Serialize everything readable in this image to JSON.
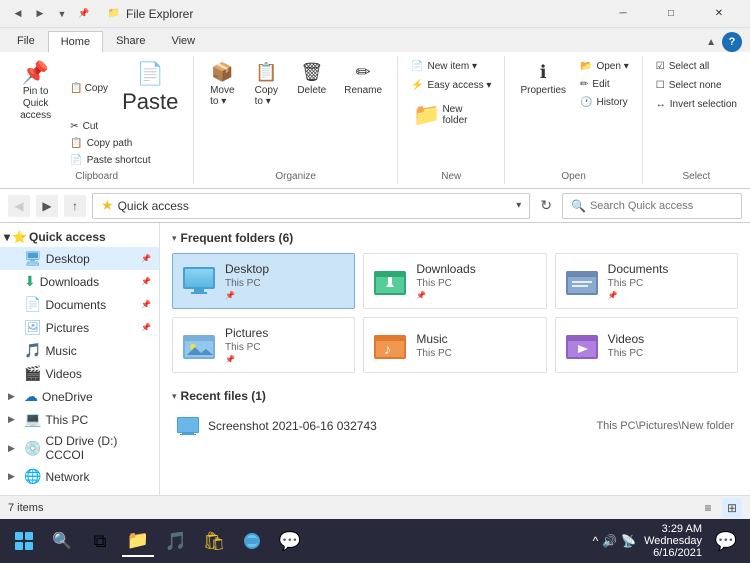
{
  "titleBar": {
    "icon": "📁",
    "title": "File Explorer",
    "minBtn": "─",
    "maxBtn": "□",
    "closeBtn": "✕",
    "quickBtns": [
      "◀",
      "▶",
      "▼",
      "▲",
      "⬛"
    ]
  },
  "ribbon": {
    "tabs": [
      "File",
      "Home",
      "Share",
      "View"
    ],
    "activeTab": "Home",
    "groups": {
      "clipboard": {
        "label": "Clipboard",
        "pinBtn": "📌",
        "buttons": [
          {
            "id": "pin",
            "icon": "📌",
            "label": "Pin to Quick\naccess"
          },
          {
            "id": "copy",
            "icon": "📋",
            "label": "Copy"
          },
          {
            "id": "paste",
            "icon": "📄",
            "label": "Paste"
          }
        ],
        "smallBtns": [
          {
            "id": "cut",
            "icon": "✂",
            "label": "Cut"
          },
          {
            "id": "copypath",
            "icon": "📋",
            "label": "Copy path"
          },
          {
            "id": "pasteshortcut",
            "icon": "📄",
            "label": "Paste shortcut"
          }
        ]
      },
      "organize": {
        "label": "Organize",
        "buttons": [
          {
            "id": "moveto",
            "icon": "📦",
            "label": "Move\nto ▾"
          },
          {
            "id": "copyto",
            "icon": "📋",
            "label": "Copy\nto ▾"
          },
          {
            "id": "delete",
            "icon": "🗑",
            "label": "Delete"
          },
          {
            "id": "rename",
            "icon": "✏",
            "label": "Rename"
          }
        ]
      },
      "new": {
        "label": "New",
        "buttons": [
          {
            "id": "newitem",
            "icon": "📄",
            "label": "New item ▾"
          },
          {
            "id": "easyaccess",
            "icon": "⚡",
            "label": "Easy access ▾"
          },
          {
            "id": "newfolder",
            "icon": "📁",
            "label": "New\nfolder"
          }
        ]
      },
      "open": {
        "label": "Open",
        "buttons": [
          {
            "id": "properties",
            "icon": "ℹ",
            "label": "Properties"
          },
          {
            "id": "open",
            "icon": "📂",
            "label": "Open ▾"
          },
          {
            "id": "edit",
            "icon": "✏",
            "label": "Edit"
          },
          {
            "id": "history",
            "icon": "🕐",
            "label": "History"
          }
        ]
      },
      "select": {
        "label": "Select",
        "buttons": [
          {
            "id": "selectall",
            "icon": "☑",
            "label": "Select all"
          },
          {
            "id": "selectnone",
            "icon": "☐",
            "label": "Select none"
          },
          {
            "id": "invertselection",
            "icon": "↔",
            "label": "Invert selection"
          }
        ]
      }
    }
  },
  "addressBar": {
    "backEnabled": false,
    "forwardEnabled": true,
    "upEnabled": true,
    "path": "Quick access",
    "searchPlaceholder": "Search Quick access"
  },
  "sidebar": {
    "groups": [
      {
        "id": "quickaccess",
        "label": "Quick access",
        "expanded": true,
        "active": true,
        "items": [
          {
            "id": "desktop",
            "icon": "🖥",
            "label": "Desktop",
            "pinned": true
          },
          {
            "id": "downloads",
            "icon": "⬇",
            "label": "Downloads",
            "pinned": true
          },
          {
            "id": "documents",
            "icon": "📄",
            "label": "Documents",
            "pinned": true
          },
          {
            "id": "pictures",
            "icon": "🖼",
            "label": "Pictures",
            "pinned": true
          },
          {
            "id": "music",
            "icon": "🎵",
            "label": "Music",
            "pinned": false
          },
          {
            "id": "videos",
            "icon": "🎬",
            "label": "Videos",
            "pinned": false
          }
        ]
      },
      {
        "id": "onedrive",
        "label": "OneDrive",
        "icon": "☁",
        "expanded": false
      },
      {
        "id": "thispc",
        "label": "This PC",
        "icon": "💻",
        "expanded": false
      },
      {
        "id": "cddrive",
        "label": "CD Drive (D:) CCCOI",
        "icon": "💿",
        "expanded": false
      },
      {
        "id": "network",
        "label": "Network",
        "icon": "🌐",
        "expanded": false
      }
    ]
  },
  "content": {
    "frequentSection": {
      "title": "Frequent folders",
      "count": 6,
      "folders": [
        {
          "id": "desktop",
          "name": "Desktop",
          "location": "This PC",
          "icon": "desktop",
          "pinned": true
        },
        {
          "id": "downloads",
          "name": "Downloads",
          "location": "This PC",
          "icon": "downloads",
          "pinned": true
        },
        {
          "id": "documents",
          "name": "Documents",
          "location": "This PC",
          "icon": "documents",
          "pinned": true
        },
        {
          "id": "pictures",
          "name": "Pictures",
          "location": "This PC",
          "icon": "pictures",
          "pinned": true
        },
        {
          "id": "music",
          "name": "Music",
          "location": "This PC",
          "icon": "music",
          "pinned": false
        },
        {
          "id": "videos",
          "name": "Videos",
          "location": "This PC",
          "icon": "videos",
          "pinned": false
        }
      ]
    },
    "recentSection": {
      "title": "Recent files",
      "count": 1,
      "files": [
        {
          "id": "screenshot",
          "name": "Screenshot 2021-06-16 032743",
          "path": "This PC\\Pictures\\New folder",
          "icon": "🖼"
        }
      ]
    }
  },
  "statusBar": {
    "itemCount": "7 items",
    "viewIcons": [
      "≡",
      "⊞"
    ]
  },
  "taskbar": {
    "icons": [
      {
        "id": "taskview",
        "icon": "⧉",
        "tooltip": "Task View"
      },
      {
        "id": "fileexplorer",
        "icon": "📁",
        "tooltip": "File Explorer",
        "active": true
      },
      {
        "id": "browser1",
        "icon": "🌊",
        "tooltip": "Browser"
      },
      {
        "id": "mediaplayer",
        "icon": "🎵",
        "tooltip": "Media Player"
      },
      {
        "id": "store",
        "icon": "🛍",
        "tooltip": "Store"
      },
      {
        "id": "browser2",
        "icon": "🌀",
        "tooltip": "Edge"
      },
      {
        "id": "chat",
        "icon": "💬",
        "tooltip": "Chat"
      }
    ],
    "systray": {
      "icons": [
        "^",
        "🔊",
        "📡"
      ],
      "time": "3:29 AM",
      "date": "Wednesday\n6/16/2021",
      "chatIcon": "💬"
    }
  }
}
